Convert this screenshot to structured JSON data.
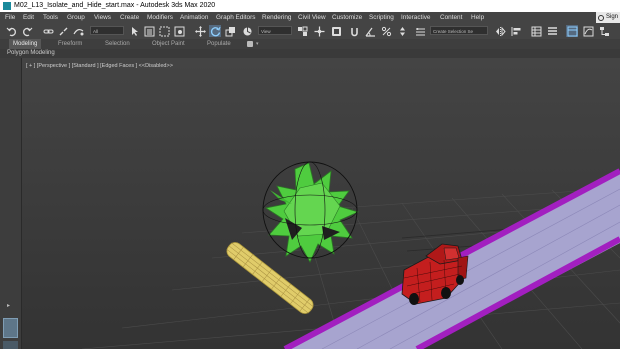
{
  "window": {
    "title": "M02_L13_Isolate_and_Hide_start.max - Autodesk 3ds Max 2020",
    "sign_in_label": "Sign"
  },
  "menu": {
    "items": [
      "File",
      "Edit",
      "Tools",
      "Group",
      "Views",
      "Create",
      "Modifiers",
      "Animation",
      "Graph Editors",
      "Rendering",
      "Civil View",
      "Customize",
      "Scripting",
      "Interactive",
      "Content",
      "Help"
    ]
  },
  "toolbar": {
    "selection_filter": "All",
    "reference_coord": "View",
    "named_selection_set": "Create Selection Se"
  },
  "ribbon": {
    "tabs": [
      "Modeling",
      "Freeform",
      "Selection",
      "Object Paint",
      "Populate"
    ],
    "active_tab": "Modeling",
    "panel_label": "Polygon Modeling"
  },
  "viewport": {
    "label": "[ + ] [Perspective ] [Standard ] [Edged Faces ]  <<Disabled>>"
  },
  "colors": {
    "ui_dark": "#444444",
    "viewport_bg": "#3b3b3b",
    "star_green": "#4fcc3f",
    "car_red": "#c41e1e",
    "road_surface": "#a7a4cf",
    "road_edge": "#a21fc0",
    "log_yellow": "#e0cc6a",
    "active_tool": "#5aa0e0"
  }
}
